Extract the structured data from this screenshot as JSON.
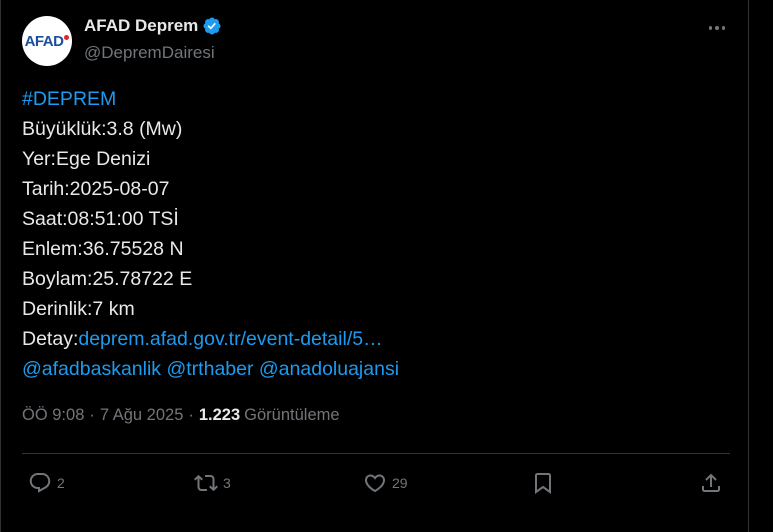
{
  "author": {
    "avatar_text": "AFAD",
    "display_name": "AFAD Deprem",
    "handle": "@DepremDairesi",
    "verified_icon": "verified-badge-icon",
    "more_icon": "more-options-icon"
  },
  "tweet": {
    "hashtag": "#DEPREM",
    "lines": [
      "Büyüklük:3.8 (Mw)",
      "Yer:Ege Denizi",
      "Tarih:2025-08-07",
      "Saat:08:51:00 TSİ",
      "Enlem:36.75528 N",
      "Boylam:25.78722 E",
      "Derinlik:7 km"
    ],
    "detail_label": "Detay:",
    "detail_link": "deprem.afad.gov.tr/event-detail/5…",
    "mentions": [
      "@afadbaskanlik",
      "@trthaber",
      "@anadoluajansi"
    ]
  },
  "meta": {
    "time": "ÖÖ 9:08",
    "separator": "·",
    "date": "7 Ağu 2025",
    "views_count": "1.223",
    "views_label": "Görüntüleme"
  },
  "actions": {
    "replies": "2",
    "retweets": "3",
    "likes": "29"
  },
  "colors": {
    "background": "#000000",
    "text": "#e7e9ea",
    "muted": "#71767b",
    "link": "#1d9bf0",
    "verified": "#1d9bf0",
    "divider": "#2f3336"
  }
}
